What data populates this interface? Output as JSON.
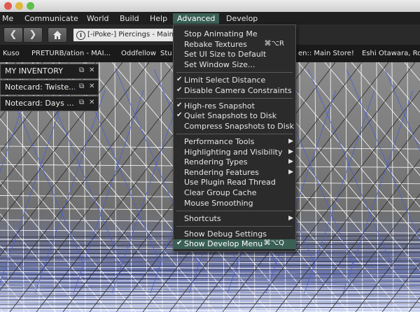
{
  "menubar": {
    "items": [
      "Me",
      "Communicate",
      "World",
      "Build",
      "Help",
      "Advanced",
      "Develop"
    ]
  },
  "navbar": {
    "back_icon": "arrow-left-icon",
    "forward_icon": "arrow-right-icon",
    "home_icon": "home-icon",
    "info_icon": "info-icon",
    "location": "[-iPoke-] Piercings - Main"
  },
  "favorites": [
    "Kuso",
    "PRETURB/ation - MAI...",
    "Oddfellow",
    "Stu",
    "en:: Main Store!",
    "Eshi Otawara, Ro"
  ],
  "floaters": [
    {
      "title": "MY INVENTORY"
    },
    {
      "title": "Notecard: Twiste..."
    },
    {
      "title": "Notecard: Days ..."
    }
  ],
  "advanced_menu": {
    "groups": [
      [
        {
          "label": "Stop Animating Me",
          "checked": false,
          "shortcut": "",
          "submenu": false
        },
        {
          "label": "Rebake Textures",
          "checked": false,
          "shortcut": "⌘⌥R",
          "submenu": false
        },
        {
          "label": "Set UI Size to Default",
          "checked": false,
          "shortcut": "",
          "submenu": false
        },
        {
          "label": "Set Window Size...",
          "checked": false,
          "shortcut": "",
          "submenu": false
        }
      ],
      [
        {
          "label": "Limit Select Distance",
          "checked": true,
          "shortcut": "",
          "submenu": false
        },
        {
          "label": "Disable Camera Constraints",
          "checked": true,
          "shortcut": "",
          "submenu": false
        }
      ],
      [
        {
          "label": "High-res Snapshot",
          "checked": true,
          "shortcut": "",
          "submenu": false
        },
        {
          "label": "Quiet Snapshots to Disk",
          "checked": true,
          "shortcut": "",
          "submenu": false
        },
        {
          "label": "Compress Snapshots to Disk",
          "checked": false,
          "shortcut": "",
          "submenu": false
        }
      ],
      [
        {
          "label": "Performance Tools",
          "checked": false,
          "shortcut": "",
          "submenu": true
        },
        {
          "label": "Highlighting and Visibility",
          "checked": false,
          "shortcut": "",
          "submenu": true
        },
        {
          "label": "Rendering Types",
          "checked": false,
          "shortcut": "",
          "submenu": true
        },
        {
          "label": "Rendering Features",
          "checked": false,
          "shortcut": "",
          "submenu": true
        },
        {
          "label": "Use Plugin Read Thread",
          "checked": false,
          "shortcut": "",
          "submenu": false
        },
        {
          "label": "Clear Group Cache",
          "checked": false,
          "shortcut": "",
          "submenu": false
        },
        {
          "label": "Mouse Smoothing",
          "checked": false,
          "shortcut": "",
          "submenu": false
        }
      ],
      [
        {
          "label": "Shortcuts",
          "checked": false,
          "shortcut": "",
          "submenu": true
        }
      ],
      [
        {
          "label": "Show Debug Settings",
          "checked": false,
          "shortcut": "",
          "submenu": false
        },
        {
          "label": "Show Develop Menu",
          "checked": true,
          "shortcut": "⌘⌥Q",
          "submenu": false,
          "highlighted": true
        }
      ]
    ]
  },
  "colors": {
    "accent": "#3a5f55",
    "menu_bg": "#2b2b2b",
    "wireframe_white": "#ffffff",
    "wireframe_blue": "#4b5fd0"
  }
}
